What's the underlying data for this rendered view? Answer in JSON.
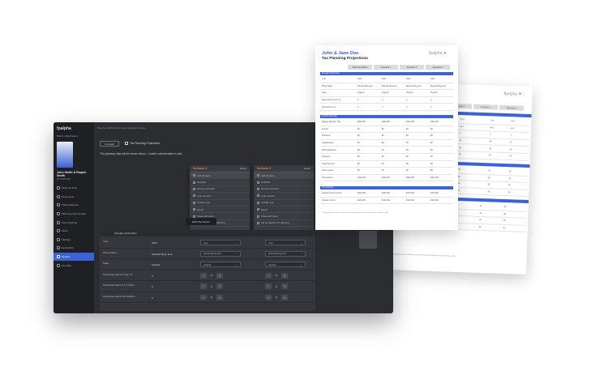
{
  "sidebar": {
    "logo": "fpalpha",
    "back": "Back to Dashboard",
    "client_name": "John Smith & Raquel Smith",
    "client_sub": "57 & 55 CFA",
    "items": [
      {
        "label": "Tasks & Notes",
        "active": false
      },
      {
        "label": "Documents",
        "active": false
      },
      {
        "label": "Shared Reports",
        "active": false
      },
      {
        "label": "Planning Opportunities",
        "active": false
      },
      {
        "label": "Team Settings",
        "active": false
      },
      {
        "label": "Alerts",
        "active": false
      },
      {
        "label": "Settings",
        "active": false
      },
      {
        "label": "Reminders",
        "active": false
      },
      {
        "label": "Reports",
        "active": true
      },
      {
        "label": "Get Help",
        "active": false
      }
    ]
  },
  "main": {
    "top_text": "See the results of the new integration review",
    "back_button": "Go back",
    "page_title": "Tax Planning Projections",
    "instruction": "The planning data will be shown below – enable customization to edit.",
    "dropdown_a": {
      "title": "Scenario 1",
      "action": "Delete",
      "items": [
        "Add scenario",
        "Duplicate",
        "Rename scenario",
        "Lock scenario",
        "Change type",
        "Export",
        "Share with client",
        "Set as baseline for planning"
      ]
    },
    "dropdown_b": {
      "title": "Scenario 2",
      "action": "Delete",
      "items": [
        "Add scenario",
        "Duplicate",
        "Rename scenario",
        "Lock scenario",
        "Change type",
        "Export",
        "Share with client",
        "Set as baseline for planning"
      ]
    },
    "tag_label": "2023 Tax Return",
    "panel": {
      "header": "Scenario Information",
      "rows": [
        {
          "label": "Year",
          "value": "2023",
          "a": "Year",
          "b": "Year"
        },
        {
          "label": "Filing Status",
          "value": "Married Filing Joint",
          "a": "Married filing joint",
          "b": "Married filing joint"
        },
        {
          "label": "State",
          "value": "Virginia",
          "a": "Virginia",
          "b": "Virginia"
        },
        {
          "label": "Total Dependents Under 17",
          "value": "0",
          "a": "0",
          "b": "0"
        },
        {
          "label": "Total Dependents 17 & Older",
          "value": "0",
          "a": "0",
          "b": "0"
        },
        {
          "label": "Total Dependents Not Eligible",
          "value": "0",
          "a": "0",
          "b": "0"
        }
      ]
    }
  },
  "doc_front": {
    "title": "John & Jane Doe",
    "subtitle": "Tax Planning Projections",
    "logo": "fpalpha",
    "tabs": [
      "2023 Tax Return",
      "Scenario 1",
      "Scenario 2",
      "Scenario 3"
    ],
    "section1": "Scenario Information",
    "section2": "Income Summary",
    "section3": "Tax Summary",
    "rows1": [
      [
        "Year",
        "2023",
        "2023",
        "2023",
        "2023"
      ],
      [
        "Filing Status",
        "Married filing joint",
        "Married filing joint",
        "Married filing joint",
        "Married filing joint"
      ],
      [
        "State",
        "Virginia",
        "Virginia",
        "Virginia",
        "Virginia"
      ],
      [
        "Dependents Under 17",
        "0",
        "0",
        "0",
        "0"
      ],
      [
        "Dependents 17+",
        "0",
        "0",
        "0",
        "0"
      ]
    ],
    "rows2": [
      [
        "Wages, Salaries, Tips",
        "$150,000",
        "$150,000",
        "$150,000",
        "$150,000"
      ],
      [
        "Interest",
        "$0",
        "$0",
        "$0",
        "$0"
      ],
      [
        "Dividends",
        "$0",
        "$0",
        "$0",
        "$0"
      ],
      [
        "Capital Gains",
        "$0",
        "$0",
        "$0",
        "$0"
      ],
      [
        "IRA Distributions",
        "$0",
        "$0",
        "$0",
        "$0"
      ],
      [
        "Pensions",
        "$0",
        "$0",
        "$0",
        "$0"
      ],
      [
        "Social Security",
        "$0",
        "$0",
        "$0",
        "$0"
      ],
      [
        "Other Income",
        "$0",
        "$0",
        "$0",
        "$0"
      ],
      [
        "Total Income",
        "$150,000",
        "$150,000",
        "$150,000",
        "$150,000"
      ]
    ],
    "rows3": [
      [
        "Adjusted Gross Income",
        "$150,000",
        "$150,000",
        "$150,000",
        "$150,000"
      ],
      [
        "Taxable Income",
        "$122,300",
        "$122,300",
        "$122,300",
        "$122,300"
      ]
    ],
    "footer": "The projections above are based on the information provided and are estimates only."
  },
  "doc_back": {
    "logo": "fpalpha",
    "tabs": [
      "Scenario 1",
      "Scenario 2",
      "Scenario 3"
    ],
    "footer": "The projections above are based on the information provided and are estimates only."
  }
}
